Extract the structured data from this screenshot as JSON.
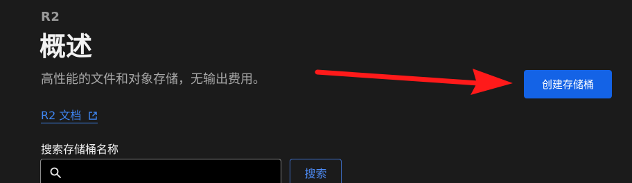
{
  "header": {
    "eyebrow": "R2",
    "title": "概述",
    "subtitle": "高性能的文件和对象存储，无输出费用。"
  },
  "docs_link": {
    "label": "R2 文档",
    "icon": "external-link-icon"
  },
  "actions": {
    "create_bucket_label": "创建存储桶"
  },
  "annotation": {
    "arrow_color": "#ff1a1a"
  },
  "search": {
    "label": "搜索存储桶名称",
    "value": "",
    "placeholder": "",
    "button_label": "搜索",
    "icon": "search-icon"
  },
  "colors": {
    "background": "#1b1b1b",
    "primary_button": "#1463e6",
    "link": "#3f86f2"
  }
}
